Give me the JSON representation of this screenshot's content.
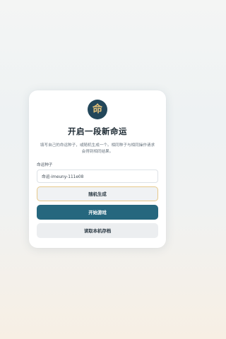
{
  "card": {
    "emblem_char": "命",
    "title": "开启一段新命运",
    "description": "填写自己的命运种子，或随机生成一个。相同种子与相同操作请求会得到相同结果。",
    "seed_label": "命运种子",
    "seed_value": "命运-imeuny-111e08",
    "random_button": "随机生成",
    "start_button": "开始游戏",
    "load_button": "读取本机存档"
  },
  "colors": {
    "emblem_bg": "#23475a",
    "emblem_fg": "#e1c07a",
    "primary": "#26677e",
    "random_border": "#e6c98a"
  },
  "icons": {
    "emblem": "fate-emblem-icon"
  }
}
